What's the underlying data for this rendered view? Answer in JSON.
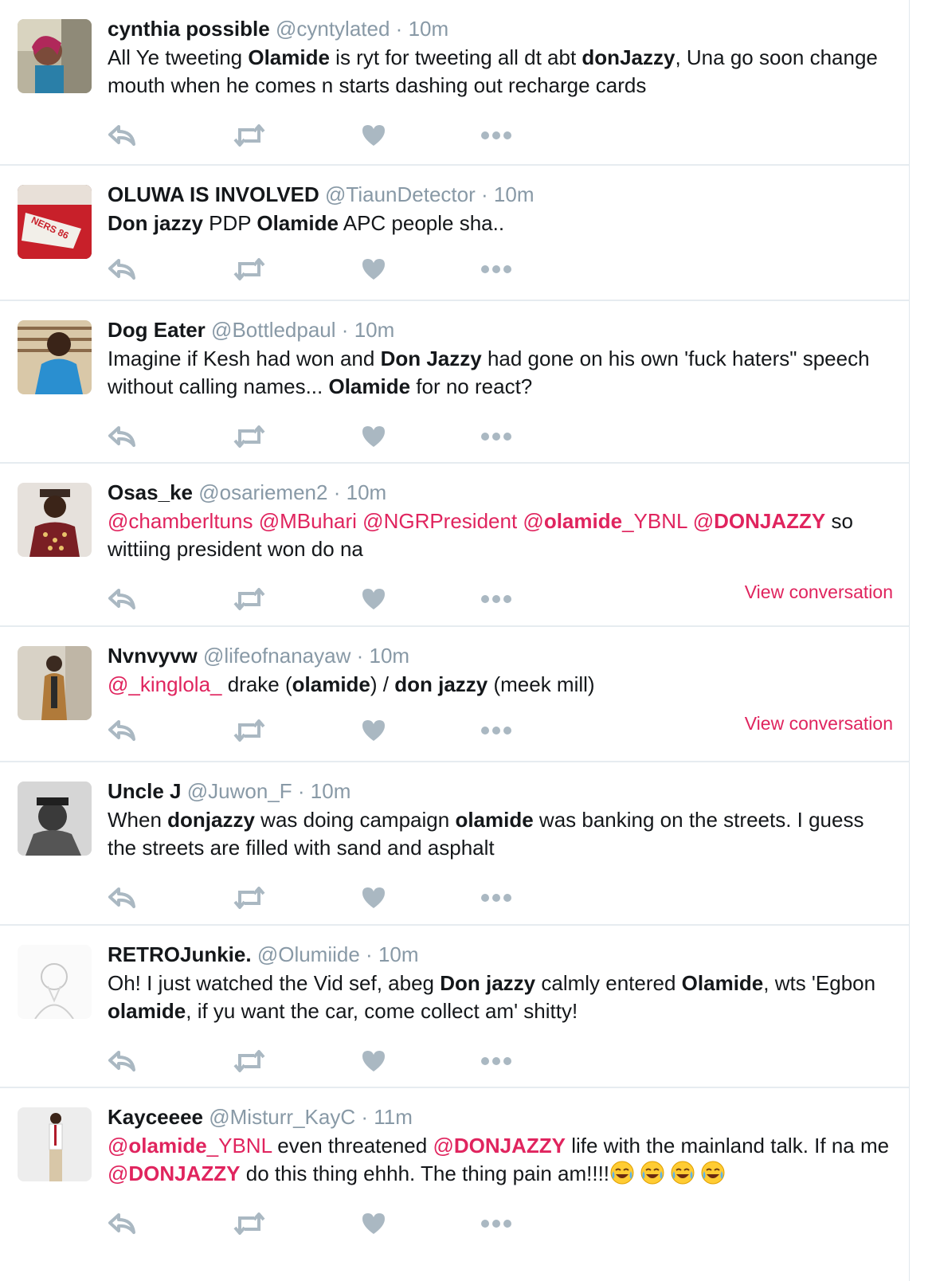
{
  "colors": {
    "accent": "#e0245e",
    "muted": "#8899a6",
    "icon": "#aab8c2",
    "divider": "#e6ecf0"
  },
  "icons": [
    "reply-icon",
    "retweet-icon",
    "like-icon",
    "more-icon"
  ],
  "tweets": [
    {
      "name": "cynthia possible",
      "handle": "@cyntylated",
      "sep": "·",
      "time": "10m",
      "parts": [
        {
          "t": "All Ye tweeting "
        },
        {
          "t": "Olamide",
          "b": true
        },
        {
          "t": " is ryt for tweeting all dt abt "
        },
        {
          "t": "donJazzy",
          "b": true
        },
        {
          "t": ", Una go soon change mouth when he comes n starts dashing out recharge cards"
        }
      ]
    },
    {
      "name": "OLUWA IS INVOLVED",
      "handle": "@TiaunDetector",
      "sep": "·",
      "time": "10m",
      "parts": [
        {
          "t": "Don jazzy",
          "b": true
        },
        {
          "t": " PDP "
        },
        {
          "t": "Olamide",
          "b": true
        },
        {
          "t": " APC people sha.."
        }
      ]
    },
    {
      "name": "Dog Eater",
      "handle": "@Bottledpaul",
      "sep": "·",
      "time": "10m",
      "parts": [
        {
          "t": "Imagine if Kesh had won and "
        },
        {
          "t": "Don Jazzy",
          "b": true
        },
        {
          "t": " had gone on his own 'fuck haters\" speech without calling names... "
        },
        {
          "t": "Olamide",
          "b": true
        },
        {
          "t": " for no react?"
        }
      ]
    },
    {
      "name": "Osas_ke",
      "handle": "@osariemen2",
      "sep": "·",
      "time": "10m",
      "parts": [
        {
          "t": "@chamberltuns",
          "m": true
        },
        {
          "t": " "
        },
        {
          "t": "@MBuhari",
          "m": true
        },
        {
          "t": " "
        },
        {
          "t": "@NGRPresident",
          "m": true
        },
        {
          "t": " "
        },
        {
          "t": "@",
          "m": true
        },
        {
          "t": "olamide",
          "m": true,
          "b": true
        },
        {
          "t": "_YBNL",
          "m": true
        },
        {
          "t": " "
        },
        {
          "t": "@",
          "m": true
        },
        {
          "t": "DONJAZZY",
          "m": true,
          "b": true
        },
        {
          "t": "  so wittiing president won do na"
        }
      ],
      "view_conversation": "View conversation"
    },
    {
      "name": "Nvnvyvw",
      "handle": "@lifeofnanayaw",
      "sep": "·",
      "time": "10m",
      "parts": [
        {
          "t": "@_kinglola_",
          "m": true
        },
        {
          "t": "  drake ("
        },
        {
          "t": "olamide",
          "b": true
        },
        {
          "t": ") / "
        },
        {
          "t": "don jazzy",
          "b": true
        },
        {
          "t": " (meek mill)"
        }
      ],
      "view_conversation": "View conversation"
    },
    {
      "name": "Uncle J",
      "handle": "@Juwon_F",
      "sep": "·",
      "time": "10m",
      "parts": [
        {
          "t": "When "
        },
        {
          "t": "donjazzy",
          "b": true
        },
        {
          "t": " was doing campaign "
        },
        {
          "t": "olamide",
          "b": true
        },
        {
          "t": " was banking on the streets. I guess the streets are filled with sand and asphalt"
        }
      ]
    },
    {
      "name": "RETROJunkie.",
      "handle": "@Olumiide",
      "sep": "·",
      "time": "10m",
      "parts": [
        {
          "t": "Oh! I just watched the Vid sef, abeg "
        },
        {
          "t": "Don jazzy",
          "b": true
        },
        {
          "t": " calmly entered "
        },
        {
          "t": "Olamide",
          "b": true
        },
        {
          "t": ", wts 'Egbon "
        },
        {
          "t": "olamide",
          "b": true
        },
        {
          "t": ", if yu want the car, come collect am' shitty!"
        }
      ]
    },
    {
      "name": "Kayceeee",
      "handle": "@Misturr_KayC",
      "sep": "·",
      "time": "11m",
      "parts": [
        {
          "t": "@",
          "m": true
        },
        {
          "t": "olamide",
          "m": true,
          "b": true
        },
        {
          "t": "_YBNL",
          "m": true
        },
        {
          "t": " even threatened "
        },
        {
          "t": "@",
          "m": true
        },
        {
          "t": "DONJAZZY",
          "m": true,
          "b": true
        },
        {
          "t": " life with the mainland talk. If na me "
        },
        {
          "t": "@",
          "m": true
        },
        {
          "t": "DONJAZZY",
          "m": true,
          "b": true
        },
        {
          "t": " do this thing ehhh. The thing pain am!!!!"
        }
      ],
      "emoji_count": 4,
      "emoji_name": "tears-of-joy-emoji"
    }
  ]
}
